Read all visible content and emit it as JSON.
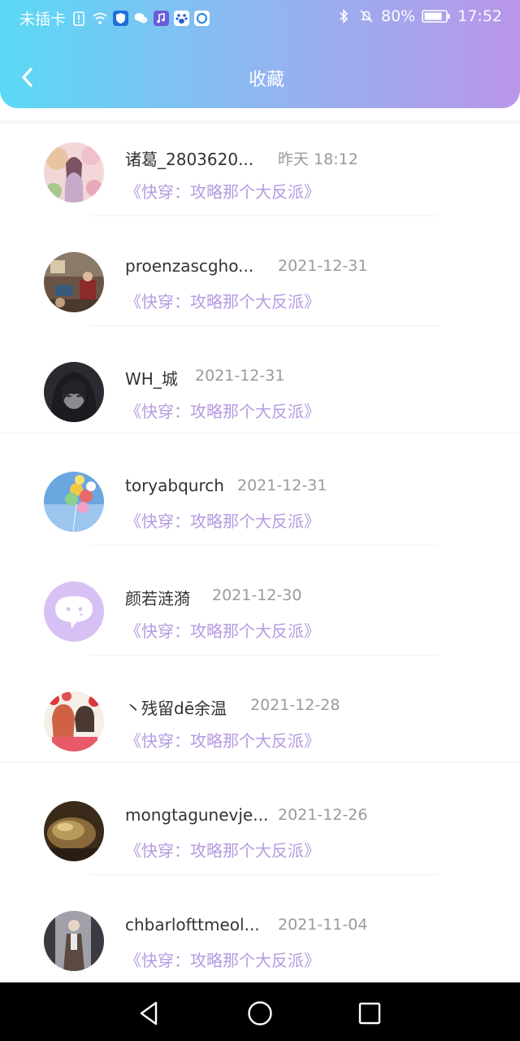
{
  "status_bar": {
    "carrier": "未插卡",
    "battery": "80%",
    "time": "17:52"
  },
  "header": {
    "title": "收藏"
  },
  "favorites": [
    {
      "name": "诸葛_2803620...",
      "date": "昨天 18:12",
      "book": "《快穿：攻略那个大反派》"
    },
    {
      "name": "proenzascgho...",
      "date": "2021-12-31",
      "book": "《快穿：攻略那个大反派》"
    },
    {
      "name": "WH_城",
      "date": "2021-12-31",
      "book": "《快穿：攻略那个大反派》"
    },
    {
      "name": "toryabqurch",
      "date": "2021-12-31",
      "book": "《快穿：攻略那个大反派》"
    },
    {
      "name": "颜若涟漪",
      "date": "2021-12-30",
      "book": "《快穿：攻略那个大反派》"
    },
    {
      "name": "丶残留dē余温",
      "date": "2021-12-28",
      "book": "《快穿：攻略那个大反派》"
    },
    {
      "name": "mongtagunevje...",
      "date": "2021-12-26",
      "book": "《快穿：攻略那个大反派》"
    },
    {
      "name": "chbarlofttmeol...",
      "date": "2021-11-04",
      "book": "《快穿：攻略那个大反派》"
    }
  ],
  "colors": {
    "header_gradient_start": "#5ad9f5",
    "header_gradient_end": "#b996ea",
    "book_title": "#b69ae0",
    "date_text": "#9a9a9a"
  }
}
